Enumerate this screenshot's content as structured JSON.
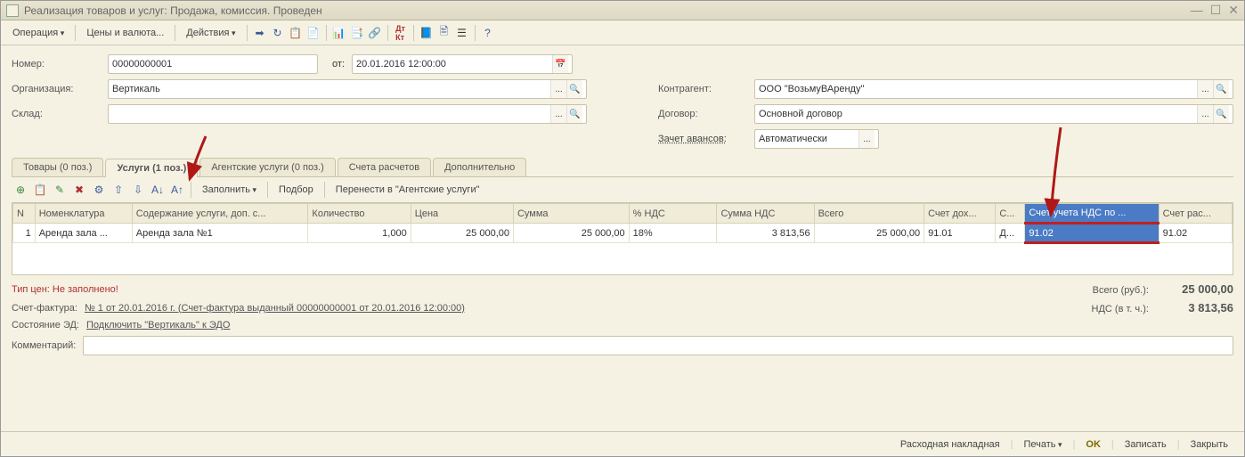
{
  "window": {
    "title": "Реализация товаров и услуг: Продажа, комиссия. Проведен"
  },
  "toolbar": {
    "operation": "Операция",
    "prices": "Цены и валюта...",
    "actions": "Действия"
  },
  "form": {
    "number_label": "Номер:",
    "number": "00000000001",
    "from_label": "от:",
    "date": "20.01.2016 12:00:00",
    "org_label": "Организация:",
    "org": "Вертикаль",
    "warehouse_label": "Склад:",
    "warehouse": "",
    "counterparty_label": "Контрагент:",
    "counterparty": "ООО \"ВозьмуВАренду\"",
    "contract_label": "Договор:",
    "contract": "Основной договор",
    "advance_label": "Зачет авансов:",
    "advance": "Автоматически"
  },
  "tabs": {
    "goods": "Товары (0 поз.)",
    "services": "Услуги (1 поз.)",
    "agent": "Агентские услуги (0 поз.)",
    "accounts": "Счета расчетов",
    "extra": "Дополнительно"
  },
  "subtoolbar": {
    "fill": "Заполнить",
    "select": "Подбор",
    "transfer": "Перенести в \"Агентские услуги\""
  },
  "table": {
    "headers": {
      "n": "N",
      "nomenclature": "Номенклатура",
      "content": "Содержание услуги, доп. с...",
      "qty": "Количество",
      "price": "Цена",
      "sum": "Сумма",
      "vat_pct": "% НДС",
      "vat_sum": "Сумма НДС",
      "total": "Всего",
      "income_acc": "Счет дох...",
      "s": "С...",
      "vat_acc": "Счет учета НДС по ...",
      "exp_acc": "Счет рас..."
    },
    "row": {
      "n": "1",
      "nomenclature": "Аренда зала ...",
      "content": "Аренда зала №1",
      "qty": "1,000",
      "price": "25 000,00",
      "sum": "25 000,00",
      "vat_pct": "18%",
      "vat_sum": "3 813,56",
      "total": "25 000,00",
      "income_acc": "91.01",
      "s": "Д...",
      "vat_acc": "91.02",
      "exp_acc": "91.02"
    }
  },
  "footer": {
    "price_type_label": "Тип цен: Не заполнено!",
    "invoice_label": "Счет-фактура:",
    "invoice_link": "№ 1 от 20.01.2016 г. (Счет-фактура выданный 00000000001 от 20.01.2016 12:00:00)",
    "ed_state_label": "Состояние ЭД:",
    "ed_state_link": "Подключить \"Вертикаль\" к ЭДО",
    "comment_label": "Комментарий:",
    "total_label": "Всего (руб.):",
    "total_val": "25 000,00",
    "vat_label": "НДС (в т. ч.):",
    "vat_val": "3 813,56"
  },
  "bottom": {
    "delivery": "Расходная накладная",
    "print": "Печать",
    "ok": "OK",
    "save": "Записать",
    "close": "Закрыть"
  }
}
